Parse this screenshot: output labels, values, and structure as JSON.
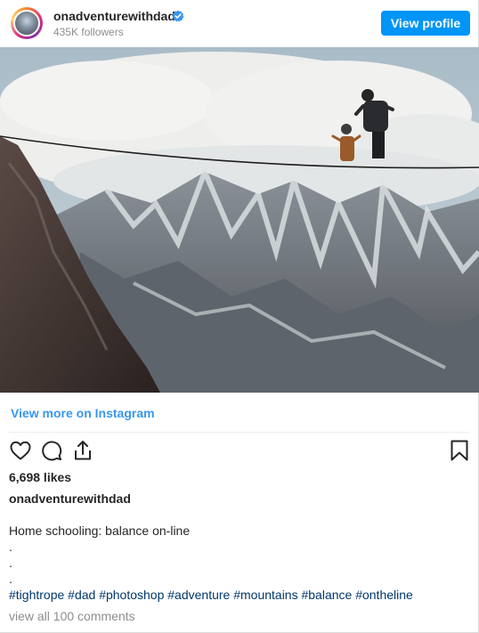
{
  "post": {
    "username": "onadventurewithdad",
    "followers": "435K followers",
    "view_profile_label": "View profile",
    "view_more_label": "View more on Instagram",
    "likes": "6,698 likes",
    "caption_username": "onadventurewithdad",
    "caption_text": "Home schooling: balance on-line",
    "caption_dots": [
      ".",
      ".",
      "."
    ],
    "hashtags": "#tightrope #dad #photoshop #adventure #mountains #balance #ontheline",
    "comments_label": "view all 100 comments"
  },
  "icons": {
    "verified": "verified-badge-icon",
    "like": "heart-icon",
    "comment": "comment-icon",
    "share": "share-icon",
    "save": "bookmark-icon"
  },
  "colors": {
    "accent": "#0095f6",
    "link": "#3897f0",
    "hashtag": "#00376b",
    "muted": "#8e8e8e",
    "text": "#262626"
  }
}
